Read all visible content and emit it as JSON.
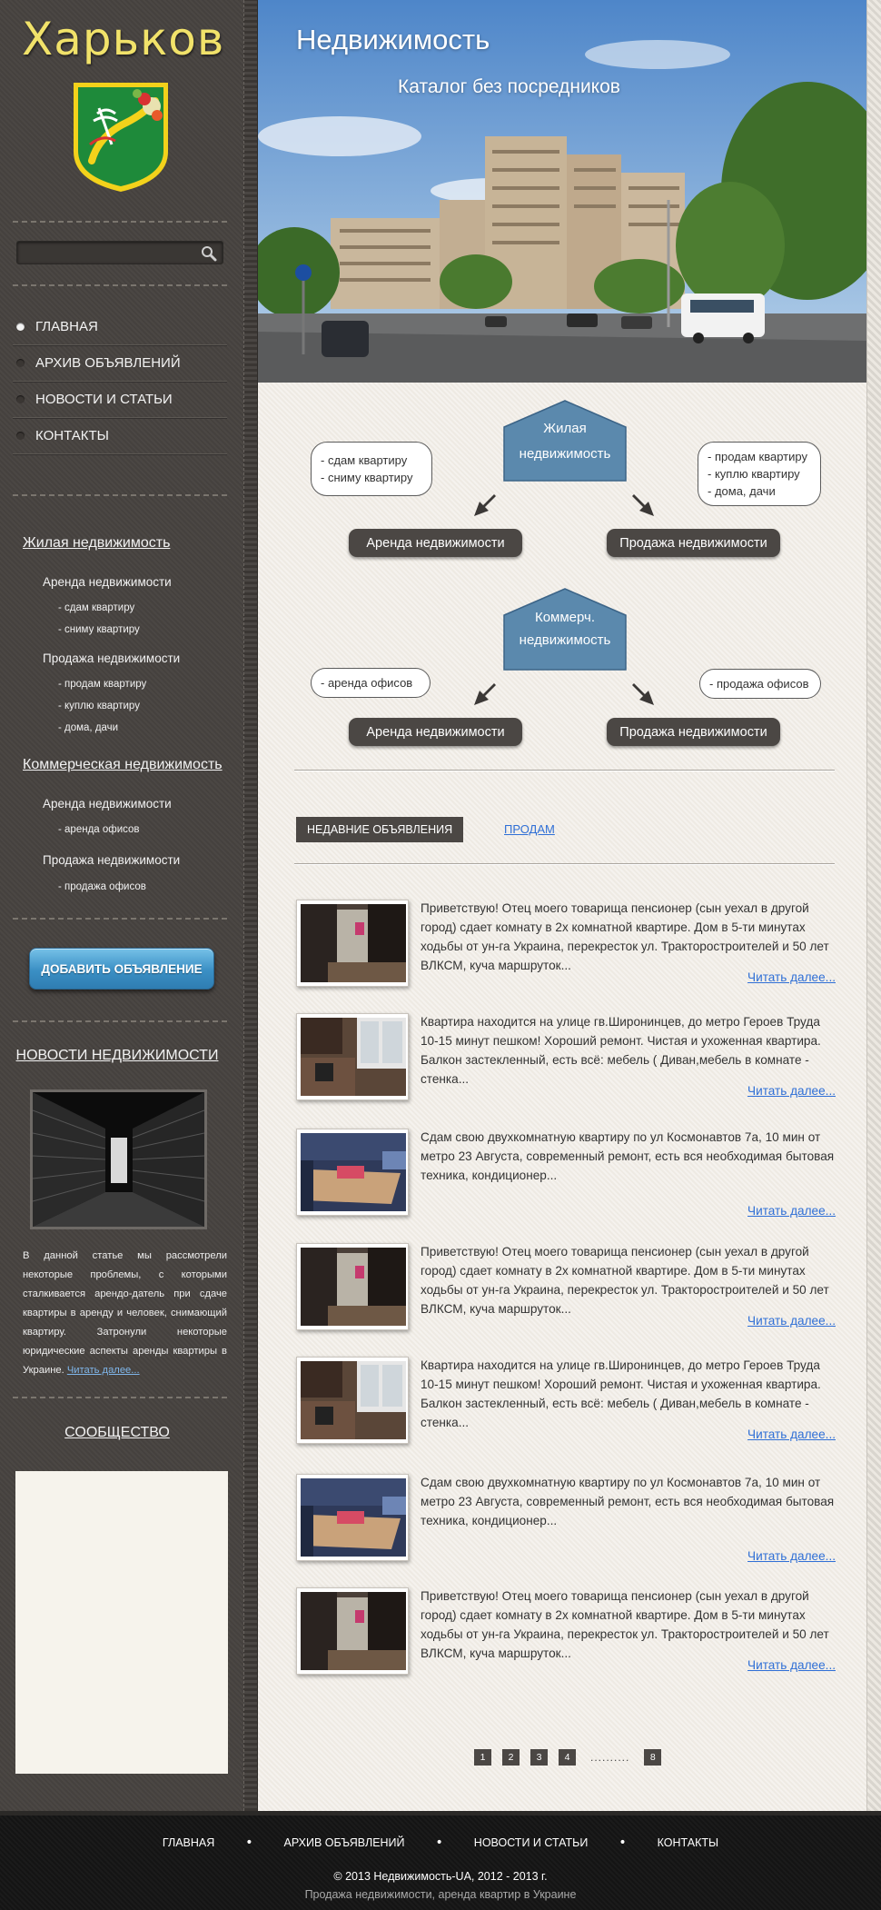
{
  "sidebar": {
    "city": "Харьков",
    "search": {
      "value": "",
      "placeholder": ""
    },
    "nav": [
      {
        "label": "ГЛАВНАЯ",
        "active": true
      },
      {
        "label": "АРХИВ ОБЪЯВЛЕНИЙ",
        "active": false
      },
      {
        "label": "НОВОСТИ И СТАТЬИ",
        "active": false
      },
      {
        "label": "КОНТАКТЫ",
        "active": false
      }
    ],
    "categories": {
      "residential": {
        "title": "Жилая недвижимость",
        "rent": {
          "title": "Аренда недвижимости",
          "items": [
            "- сдам квартиру",
            "- сниму квартиру"
          ]
        },
        "sale": {
          "title": "Продажа недвижимости",
          "items": [
            "- продам квартиру",
            "- куплю квартиру",
            "- дома, дачи"
          ]
        }
      },
      "commercial": {
        "title": "Коммерческая недвижимость",
        "rent": {
          "title": "Аренда недвижимости",
          "items": [
            "- аренда офисов"
          ]
        },
        "sale": {
          "title": "Продажа недвижимости",
          "items": [
            "- продажа офисов"
          ]
        }
      }
    },
    "add_button": "ДОБАВИТЬ ОБЪЯВЛЕНИЕ",
    "news": {
      "title": "НОВОСТИ НЕДВИЖИМОСТИ",
      "text": "В данной статье мы рассмотрели некоторые проблемы, с которыми сталкивается арендо-датель при сдаче квартиры в аренду и человек, снимающий квартиру. Затронули некоторые юридические аспекты аренды квартиры в Украине.",
      "more": "Читать далее..."
    },
    "community_title": "СООБЩЕСТВО"
  },
  "hero": {
    "title": "Недвижимость",
    "subtitle": "Каталог без посредников"
  },
  "diagram": {
    "residential": {
      "house": [
        "Жилая",
        "недвижимость"
      ],
      "left_bubble": [
        "- сдам квартиру",
        "- сниму квартиру"
      ],
      "right_bubble": [
        "- продам квартиру",
        "- куплю квартиру",
        "- дома, дачи"
      ],
      "left_pill": "Аренда недвижимости",
      "right_pill": "Продажа недвижимости"
    },
    "commercial": {
      "house": [
        "Коммерч.",
        "недвижимость"
      ],
      "left_bubble": [
        "- аренда офисов"
      ],
      "right_bubble": [
        "- продажа офисов"
      ],
      "left_pill": "Аренда недвижимости",
      "right_pill": "Продажа недвижимости"
    }
  },
  "tabs": {
    "active": "НЕДАВНИЕ ОБЪЯВЛЕНИЯ",
    "other": "ПРОДАМ"
  },
  "listings": [
    {
      "text": "Приветствую! Отец моего товарища пенсионер (сын уехал в другой город) сдает комнату в 2х комнатной квартире. Дом в 5-ти минутах ходьбы от ун-га Украина, перекресток ул. Тракторостроителей и 50 лет ВЛКСМ, куча маршруток...",
      "more": "Читать далее...",
      "photo": "room-photo"
    },
    {
      "text": "Квартира находится на улице гв.Широнинцев, до метро Героев Труда 10-15 минут пешком! Хороший ремонт. Чистая и ухоженная квартира. Балкон застекленный, есть всё: мебель ( Диван,мебель в комнате - стенка...",
      "more": "Читать далее...",
      "photo": "kitchen-photo"
    },
    {
      "text": "Сдам свою двухкомнатную квартиру по ул Космонавтов 7а, 10 мин от метро 23 Августа, современный ремонт, есть вся необходимая бытовая техника, кондиционер...",
      "more": "Читать далее...",
      "photo": "table-photo"
    },
    {
      "text": "Приветствую! Отец моего товарища пенсионер (сын уехал в другой город) сдает комнату в 2х комнатной квартире. Дом в 5-ти минутах ходьбы от ун-га Украина, перекресток ул. Тракторостроителей и 50 лет ВЛКСМ, куча маршруток...",
      "more": "Читать далее...",
      "photo": "room-photo"
    },
    {
      "text": "Квартира находится на улице гв.Широнинцев, до метро Героев Труда 10-15 минут пешком! Хороший ремонт. Чистая и ухоженная квартира. Балкон застекленный, есть всё: мебель ( Диван,мебель в комнате - стенка...",
      "more": "Читать далее...",
      "photo": "kitchen-photo"
    },
    {
      "text": "Сдам свою двухкомнатную квартиру по ул Космонавтов 7а, 10 мин от метро 23 Августа, современный ремонт, есть вся необходимая бытовая техника, кондиционер...",
      "more": "Читать далее...",
      "photo": "table-photo"
    },
    {
      "text": "Приветствую! Отец моего товарища пенсионер (сын уехал в другой город) сдает комнату в 2х комнатной квартире. Дом в 5-ти минутах ходьбы от ун-га Украина, перекресток ул. Тракторостроителей и 50 лет ВЛКСМ, куча маршруток...",
      "more": "Читать далее...",
      "photo": "room-photo"
    }
  ],
  "pager": {
    "pages": [
      "1",
      "2",
      "3",
      "4"
    ],
    "ellipsis": "..........",
    "last": "8"
  },
  "footer": {
    "nav": [
      "ГЛАВНАЯ",
      "АРХИВ ОБЪЯВЛЕНИЙ",
      "НОВОСТИ И СТАТЬИ",
      "КОНТАКТЫ"
    ],
    "copyright": "© 2013 Недвижимость-UA, 2012 - 2013 г.",
    "tagline": "Продажа недвижимости, аренда квартир в Украине"
  },
  "colors": {
    "accent_blue": "#5b89ad",
    "pill_dark": "#4b4744",
    "link_blue": "#2f6fd6",
    "city_yellow": "#f1e26a",
    "sidebar_bg": "#474340"
  }
}
